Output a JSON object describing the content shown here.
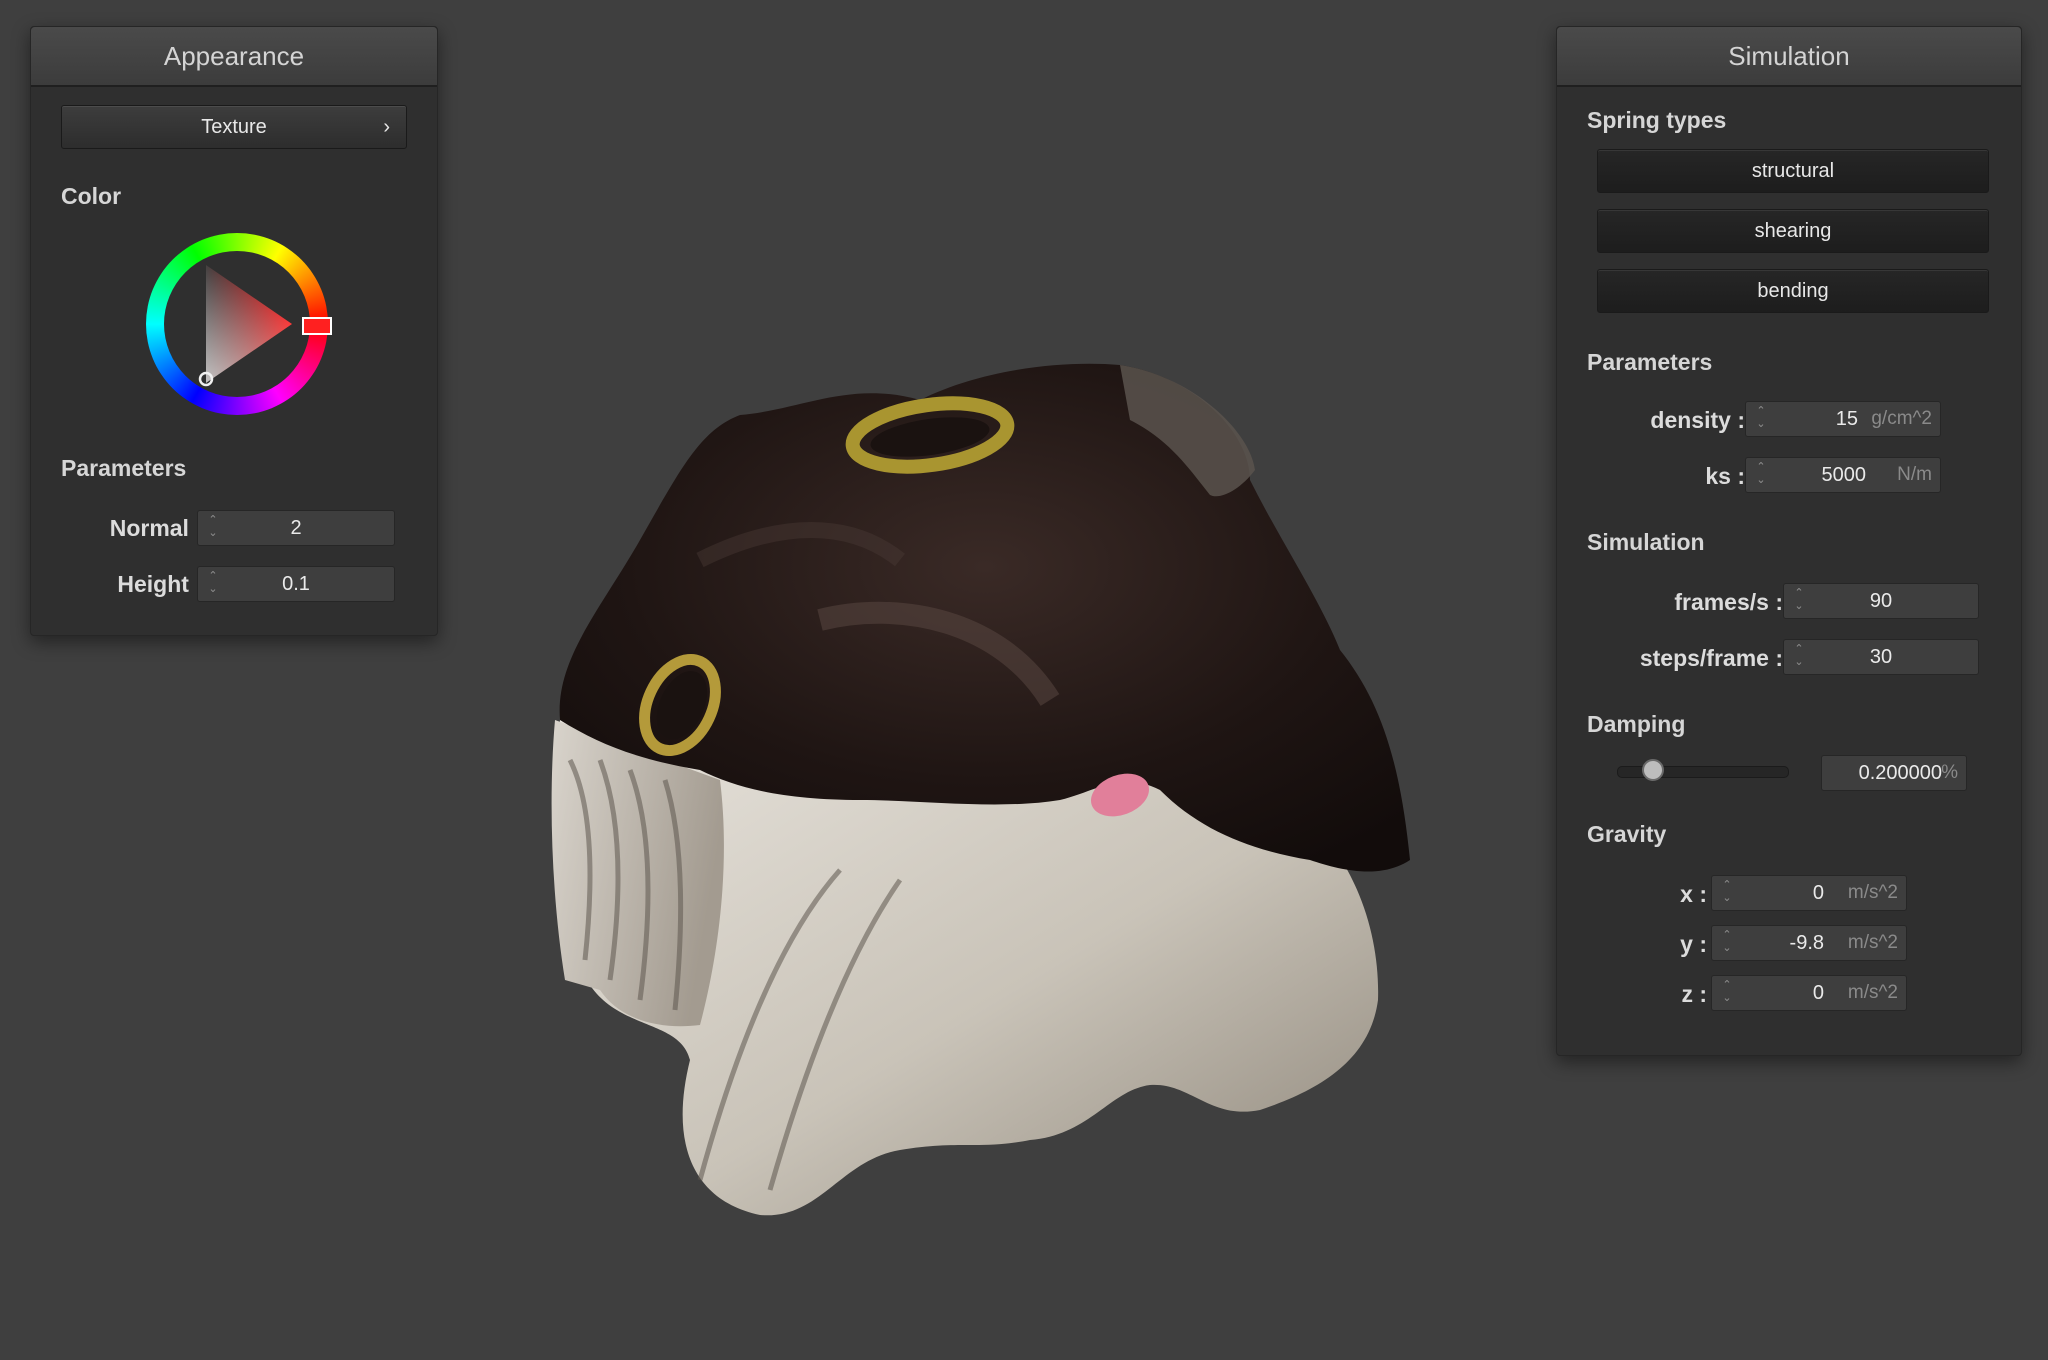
{
  "appearance": {
    "title": "Appearance",
    "texture_button": "Texture",
    "texture_chevron": "›",
    "color_label": "Color",
    "selected_color": "#ff2020",
    "parameters_label": "Parameters",
    "normal_label": "Normal :",
    "normal_value": "2",
    "height_label": "Height :",
    "height_value": "0.1"
  },
  "simulation": {
    "title": "Simulation",
    "spring_types_label": "Spring types",
    "spring_buttons": [
      "structural",
      "shearing",
      "bending"
    ],
    "parameters_label": "Parameters",
    "density_label": "density :",
    "density_value": "15",
    "density_unit": "g/cm^2",
    "ks_label": "ks :",
    "ks_value": "5000",
    "ks_unit": "N/m",
    "simulation_label": "Simulation",
    "fps_label": "frames/s :",
    "fps_value": "90",
    "steps_label": "steps/frame :",
    "steps_value": "30",
    "damping_label": "Damping",
    "damping_value": "0.200000",
    "damping_unit": "%",
    "damping_slider_fraction": 0.2,
    "gravity_label": "Gravity",
    "gx_label": "x :",
    "gx_value": "0",
    "gx_unit": "m/s^2",
    "gy_label": "y :",
    "gy_value": "-9.8",
    "gy_unit": "m/s^2",
    "gz_label": "z :",
    "gz_value": "0",
    "gz_unit": "m/s^2"
  },
  "icons": {
    "spinner": "up-down-arrows-icon",
    "chevron": "chevron-right-icon"
  }
}
